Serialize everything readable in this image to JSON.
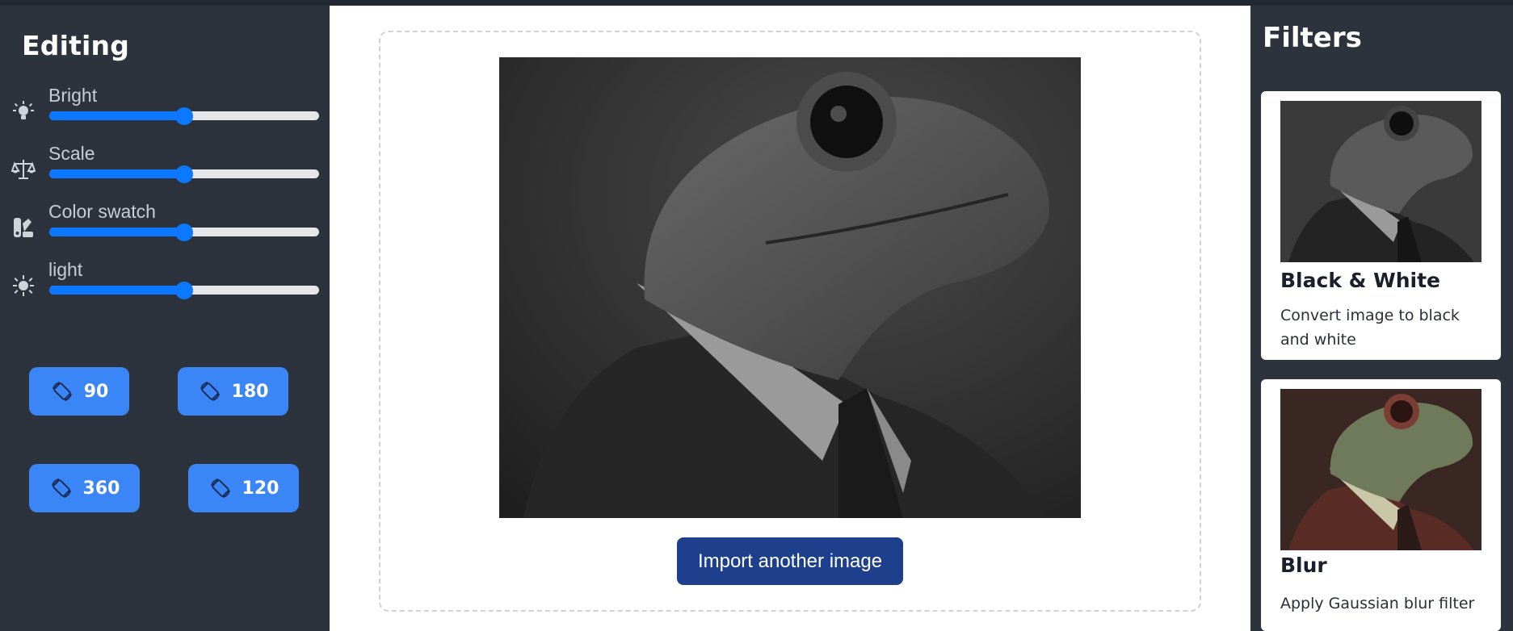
{
  "sidebar": {
    "title": "Editing",
    "adjustments": [
      {
        "label": "Bright",
        "icon": "lightbulb-icon",
        "value_percent": 50
      },
      {
        "label": "Scale",
        "icon": "balance-scale-icon",
        "value_percent": 50
      },
      {
        "label": "Color swatch",
        "icon": "color-swatch-icon",
        "value_percent": 50
      },
      {
        "label": "light",
        "icon": "sun-icon",
        "value_percent": 50
      }
    ],
    "rotate_buttons": [
      {
        "label": "90",
        "icon": "rotate-icon"
      },
      {
        "label": "180",
        "icon": "rotate-icon"
      },
      {
        "label": "360",
        "icon": "rotate-icon"
      },
      {
        "label": "120",
        "icon": "rotate-icon"
      }
    ]
  },
  "main": {
    "image_icon": "frog-portrait-image",
    "import_label": "Import another image"
  },
  "filters": {
    "title": "Filters",
    "cards": [
      {
        "title": "Black & White",
        "description": "Convert image to black and white",
        "thumb": "frog-portrait-bw-thumbnail"
      },
      {
        "title": "Blur",
        "description": "Apply Gaussian blur filter",
        "thumb": "frog-portrait-color-thumbnail"
      }
    ]
  },
  "colors": {
    "sidebar_bg": "#2d333d",
    "slider_accent": "#0b78ff",
    "rotate_button": "#3b86f6",
    "import_button": "#1d3f8c"
  }
}
